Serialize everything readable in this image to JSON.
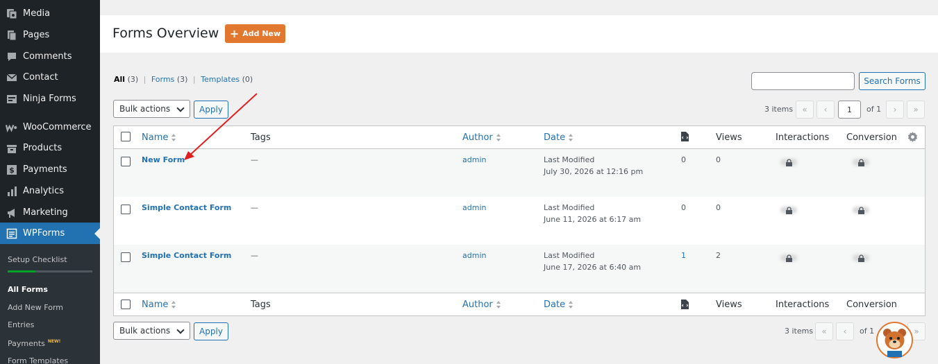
{
  "sidebar": {
    "items": [
      {
        "label": "Media",
        "icon": "media-icon"
      },
      {
        "label": "Pages",
        "icon": "pages-icon"
      },
      {
        "label": "Comments",
        "icon": "comments-icon"
      },
      {
        "label": "Contact",
        "icon": "contact-icon"
      },
      {
        "label": "Ninja Forms",
        "icon": "ninja-forms-icon"
      },
      {
        "label": "WooCommerce",
        "icon": "woocommerce-icon"
      },
      {
        "label": "Products",
        "icon": "products-icon"
      },
      {
        "label": "Payments",
        "icon": "payments-icon"
      },
      {
        "label": "Analytics",
        "icon": "analytics-icon"
      },
      {
        "label": "Marketing",
        "icon": "marketing-icon"
      },
      {
        "label": "WPForms",
        "icon": "wpforms-icon"
      }
    ],
    "submenu": {
      "setup_checklist": "Setup Checklist",
      "setup_progress": 0.33,
      "all_forms": "All Forms",
      "add_new_form": "Add New Form",
      "entries": "Entries",
      "payments": "Payments",
      "payments_badge": "NEW!",
      "form_templates": "Form Templates"
    }
  },
  "header": {
    "title": "Forms Overview",
    "add_new": "Add New"
  },
  "filters": {
    "all": "All",
    "all_count": "(3)",
    "forms": "Forms",
    "forms_count": "(3)",
    "templates": "Templates",
    "templates_count": "(0)"
  },
  "search": {
    "button": "Search Forms",
    "value": ""
  },
  "bulk": {
    "label": "Bulk actions",
    "apply": "Apply"
  },
  "pagination": {
    "items": "3 items",
    "current_page": "1",
    "of": "of 1",
    "first": "«",
    "prev": "‹",
    "next": "›",
    "last": "»"
  },
  "table": {
    "columns": {
      "name": "Name",
      "tags": "Tags",
      "author": "Author",
      "date": "Date",
      "views": "Views",
      "interactions": "Interactions",
      "conversion": "Conversion"
    },
    "rows": [
      {
        "name": "New Form",
        "tags": "—",
        "author": "admin",
        "date_label": "Last Modified",
        "date": "July 30, 2026 at 12:16 pm",
        "entries": "0",
        "views": "0"
      },
      {
        "name": "Simple Contact Form",
        "tags": "—",
        "author": "admin",
        "date_label": "Last Modified",
        "date": "June 11, 2026 at 6:17 am",
        "entries": "0",
        "views": "0"
      },
      {
        "name": "Simple Contact Form",
        "tags": "—",
        "author": "admin",
        "date_label": "Last Modified",
        "date": "June 17, 2026 at 6:40 am",
        "entries": "1",
        "views": "2"
      }
    ]
  },
  "colors": {
    "accent": "#2271b1",
    "brand_orange": "#e27730",
    "sidebar_bg": "#1d2327",
    "annotation_arrow": "#e02020"
  }
}
